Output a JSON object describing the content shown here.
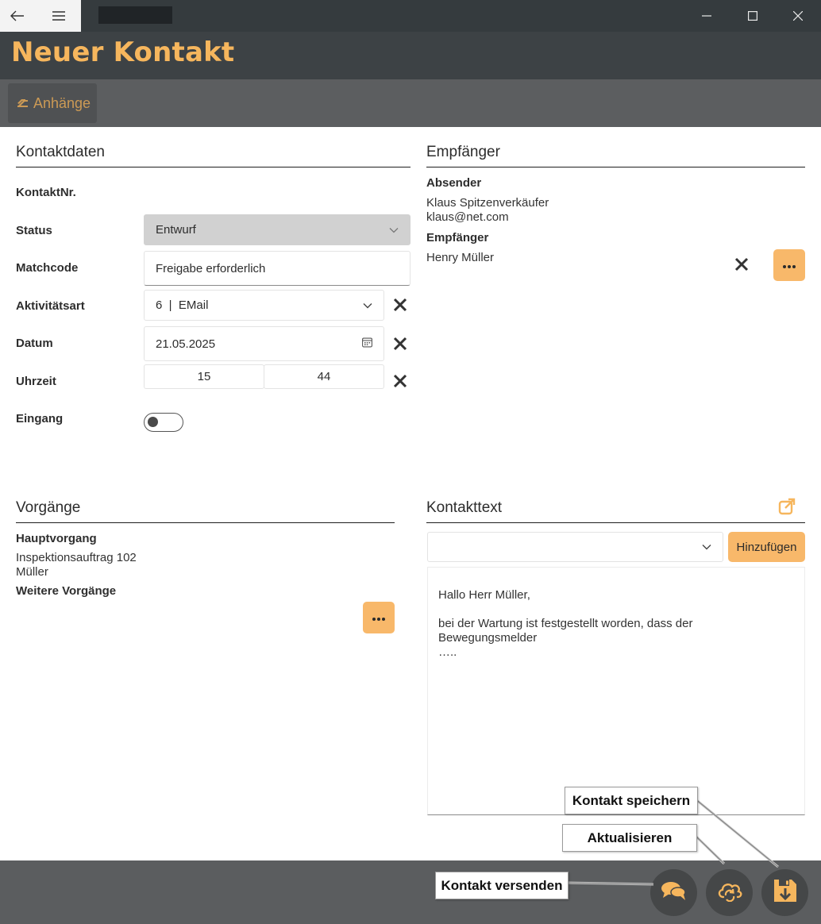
{
  "window": {
    "back_icon": "back-arrow-icon",
    "menu_icon": "hamburger-icon",
    "minimize_icon": "minimize-icon",
    "maximize_icon": "maximize-icon",
    "close_icon": "close-icon"
  },
  "header": {
    "title": "Neuer Kontakt"
  },
  "toolbar": {
    "attachments_label": "Anhänge"
  },
  "kontaktdaten": {
    "title": "Kontaktdaten",
    "kontaktnr_label": "KontaktNr.",
    "status_label": "Status",
    "status_value": "Entwurf",
    "matchcode_label": "Matchcode",
    "matchcode_value": "Freigabe erforderlich",
    "aktivitaetsart_label": "Aktivitätsart",
    "aktivitaetsart_value": "6  |  EMail",
    "datum_label": "Datum",
    "datum_value": "21.05.2025",
    "uhrzeit_label": "Uhrzeit",
    "uhrzeit_hour": "15",
    "uhrzeit_minute": "44",
    "eingang_label": "Eingang",
    "eingang_on": false
  },
  "empfaenger": {
    "title": "Empfänger",
    "absender_label": "Absender",
    "absender_name": "Klaus Spitzenverkäufer",
    "absender_email": "klaus@net.com",
    "empfaenger_label": "Empfänger",
    "empfaenger_name": "Henry Müller"
  },
  "vorgaenge": {
    "title": "Vorgänge",
    "hauptvorgang_label": "Hauptvorgang",
    "hauptvorgang_line1": "Inspektionsauftrag 102",
    "hauptvorgang_line2": "Müller",
    "weitere_label": "Weitere Vorgänge"
  },
  "kontakttext": {
    "title": "Kontakttext",
    "template_value": "",
    "add_button_label": "Hinzufügen",
    "body_line1": "Hallo Herr Müller,",
    "body_line2": "bei der Wartung ist festgestellt worden, dass der Bewegungsmelder",
    "body_line3": "….."
  },
  "footer": {
    "send_icon": "chat-send-icon",
    "refresh_icon": "cloud-sync-icon",
    "save_icon": "save-disk-icon"
  },
  "callouts": {
    "save": "Kontakt speichern",
    "refresh": "Aktualisieren",
    "send": "Kontakt versenden"
  },
  "colors": {
    "accent": "#f6b65d",
    "button_orange": "#f8b86a",
    "titlebar": "#353b3e",
    "header": "#3d4245",
    "toolbar": "#5c5e60",
    "footer": "#5b5d5f"
  }
}
